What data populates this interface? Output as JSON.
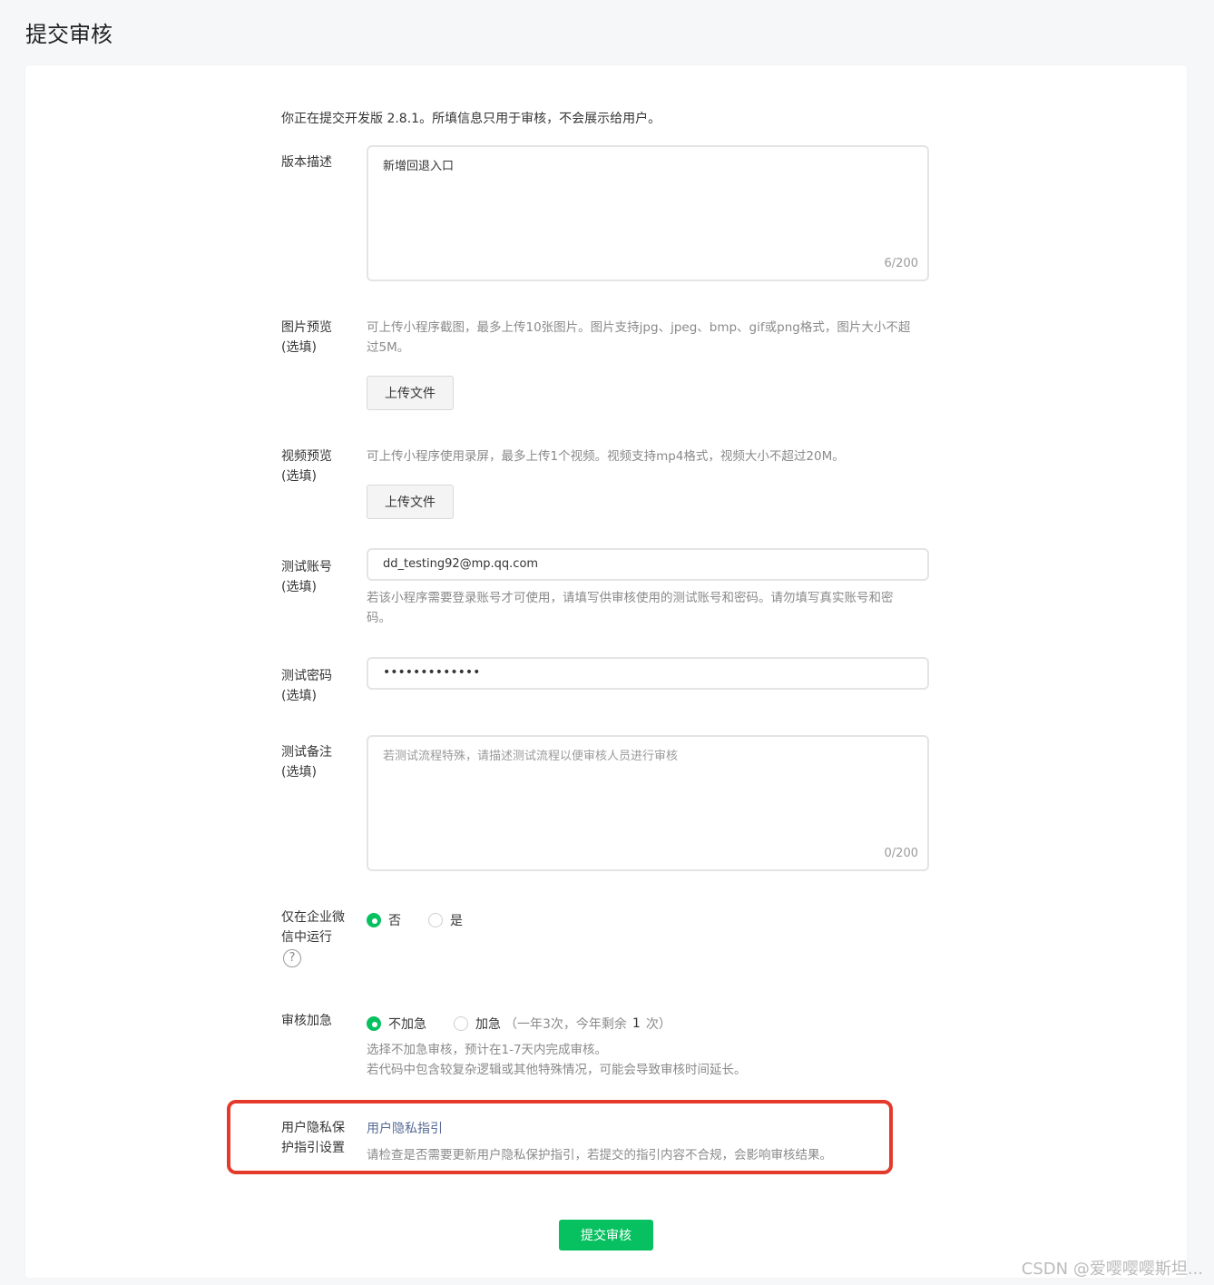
{
  "page": {
    "title": "提交审核"
  },
  "intro": "你正在提交开发版 2.8.1。所填信息只用于审核，不会展示给用户。",
  "version_desc": {
    "label": "版本描述",
    "value": "新增回退入口",
    "counter": "6/200"
  },
  "image_preview": {
    "label_line1": "图片预览",
    "label_line2": "(选填)",
    "hint_line1": "可上传小程序截图，最多上传10张图片。图片支持jpg、jpeg、bmp、gif或png格式，图片大小不超",
    "hint_line2": "过5M。",
    "button": "上传文件"
  },
  "video_preview": {
    "label_line1": "视频预览",
    "label_line2": "(选填)",
    "hint": "可上传小程序使用录屏，最多上传1个视频。视频支持mp4格式，视频大小不超过20M。",
    "button": "上传文件"
  },
  "test_account": {
    "label_line1": "测试账号",
    "label_line2": "(选填)",
    "value": "dd_testing92@mp.qq.com",
    "hint_line1": "若该小程序需要登录账号才可使用，请填写供审核使用的测试账号和密码。请勿填写真实账号和密",
    "hint_line2": "码。"
  },
  "test_password": {
    "label_line1": "测试密码",
    "label_line2": "(选填)",
    "value": "•••••••••••••"
  },
  "test_notes": {
    "label_line1": "测试备注",
    "label_line2": "(选填)",
    "placeholder": "若测试流程特殊，请描述测试流程以便审核人员进行审核",
    "counter": "0/200"
  },
  "wecom_only": {
    "label_line1": "仅在企业微",
    "label_line2": "信中运行",
    "help": "?",
    "option_no": "否",
    "option_yes": "是",
    "selected": "否"
  },
  "expedite": {
    "label": "审核加急",
    "option_no": "不加急",
    "option_yes": "加急",
    "option_yes_note_prefix": "（一年3次，今年剩余",
    "remaining": "1",
    "option_yes_note_suffix": "次）",
    "hint_line1": "选择不加急审核，预计在1-7天内完成审核。",
    "hint_line2": "若代码中包含较复杂逻辑或其他特殊情况，可能会导致审核时间延长。",
    "selected": "不加急"
  },
  "privacy": {
    "label_line1": "用户隐私保",
    "label_line2": "护指引设置",
    "link": "用户隐私指引",
    "hint": "请检查是否需要更新用户隐私保护指引，若提交的指引内容不合规，会影响审核结果。"
  },
  "submit": {
    "label": "提交审核"
  },
  "watermark": "CSDN @爱嘤嘤嘤斯坦...",
  "colors": {
    "primary": "#07c160",
    "link": "#576b95",
    "highlight": "#e33a2c"
  }
}
